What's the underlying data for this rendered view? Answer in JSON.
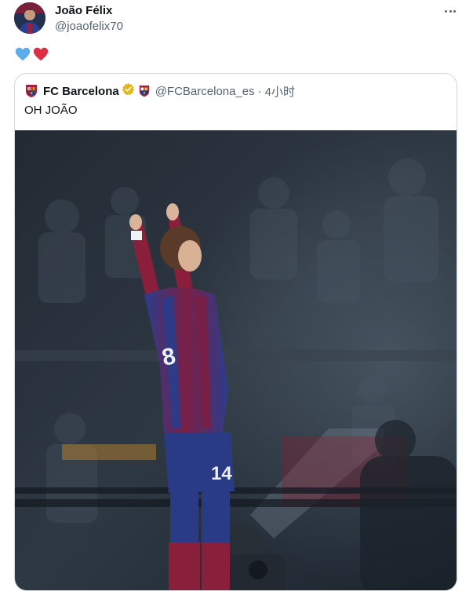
{
  "tweet": {
    "author_name": "João Félix",
    "author_handle": "@joaofelix70",
    "more_icon": "more-horizontal-icon",
    "text_emojis": [
      "blue-heart",
      "red-heart"
    ]
  },
  "quoted": {
    "author_name": "FC Barcelona",
    "verified_badge": "gold-verified-badge",
    "handle": "@FCBarcelona_es",
    "separator": "·",
    "time": "4小时",
    "text": "OH JOÃO"
  },
  "photo": {
    "jersey_number": "14",
    "description_icon": "celebrating-player-photo"
  },
  "colors": {
    "blue_heart": "#5dadec",
    "red_heart": "#dd2e44",
    "verified_gold": "#e2b719",
    "barca_blue": "#1f3a8a",
    "barca_red": "#a3203f"
  }
}
